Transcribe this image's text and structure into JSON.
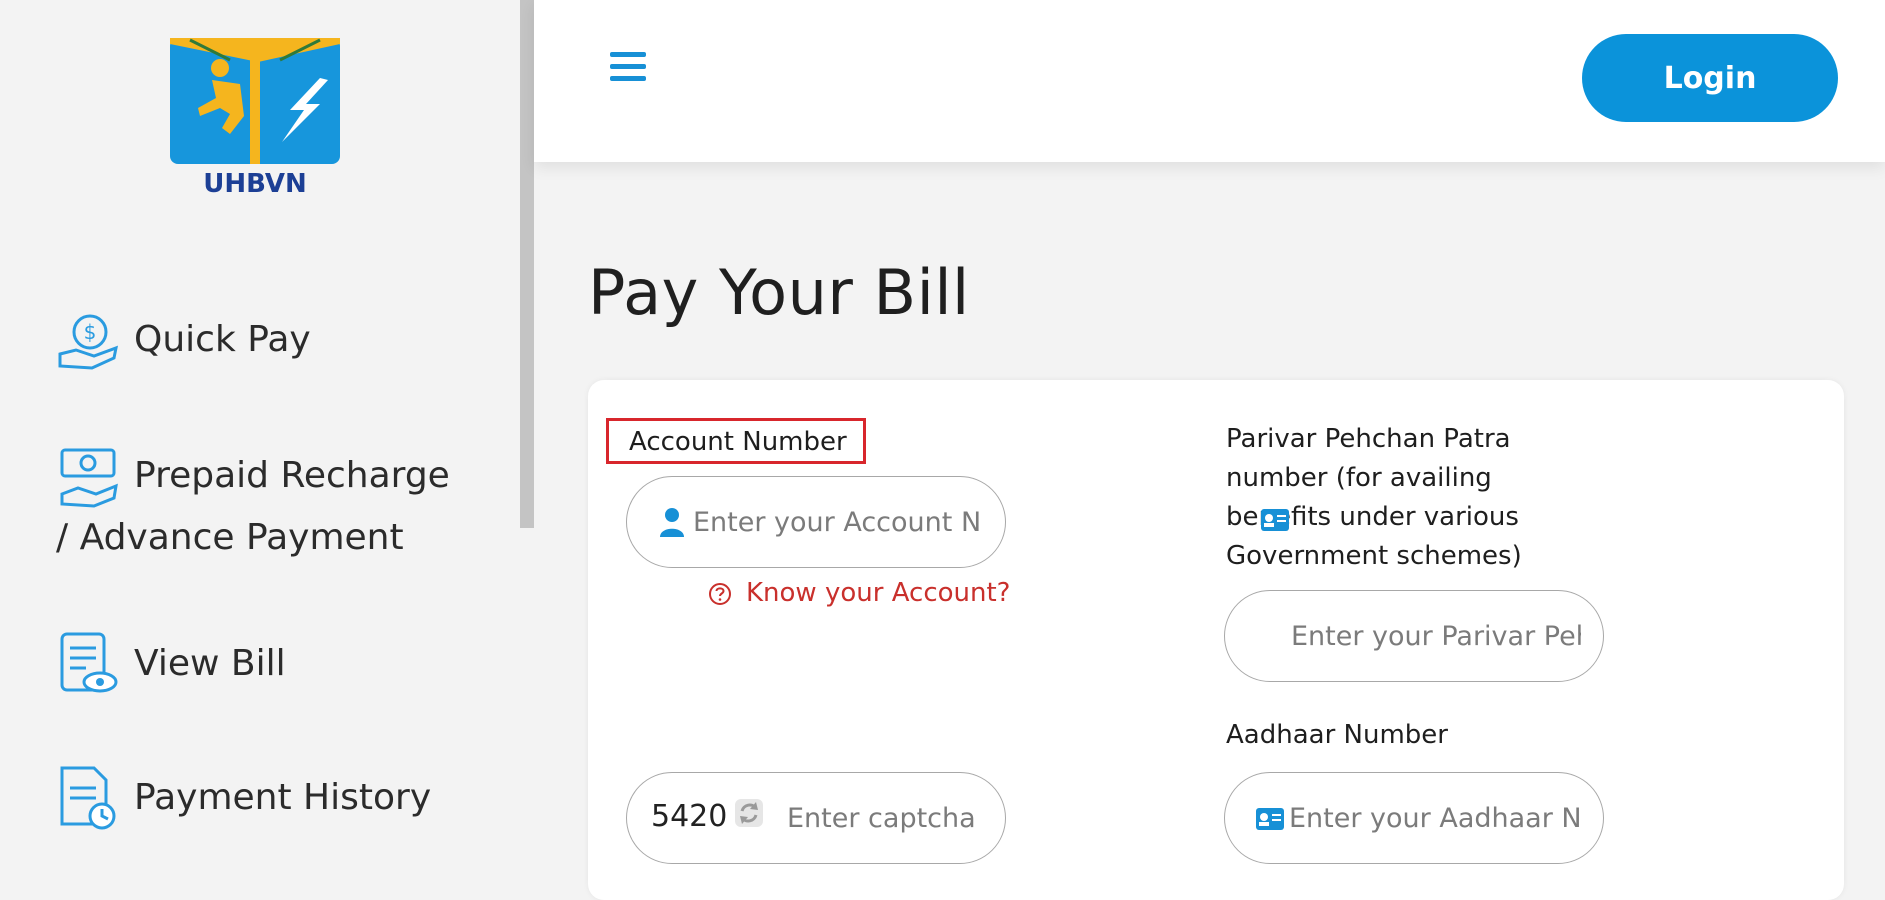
{
  "brand": {
    "logo_text": "UHBVN",
    "accent_color": "#0b93da",
    "icon_color": "#2a9be0"
  },
  "sidebar": {
    "items": [
      {
        "label": "Quick Pay",
        "icon": "hand-dollar-icon"
      },
      {
        "label_line1": "Prepaid Recharge",
        "label_line2": "/ Advance Payment",
        "icon": "cash-hand-icon"
      },
      {
        "label": "View Bill",
        "icon": "bill-eye-icon"
      },
      {
        "label": "Payment History",
        "icon": "document-clock-icon"
      }
    ]
  },
  "header": {
    "menu_icon": "hamburger-icon",
    "login_label": "Login"
  },
  "main": {
    "title": "Pay Your Bill",
    "form": {
      "account": {
        "label": "Account Number",
        "placeholder": "Enter your Account Number",
        "icon": "user-icon",
        "help_link": "Know your Account?",
        "help_icon": "question-circle-icon"
      },
      "ppp": {
        "label": "Parivar Pehchan Patra number (for availing benefits under various Government schemes)",
        "placeholder": "Enter your Parivar Pehchan Patra number",
        "icon": "id-card-icon"
      },
      "aadhaar": {
        "label": "Aadhaar Number",
        "placeholder": "Enter your Aadhaar Number",
        "icon": "id-card-icon"
      },
      "captcha": {
        "code": "5420",
        "placeholder": "Enter captcha",
        "refresh_icon": "refresh-icon"
      }
    }
  }
}
